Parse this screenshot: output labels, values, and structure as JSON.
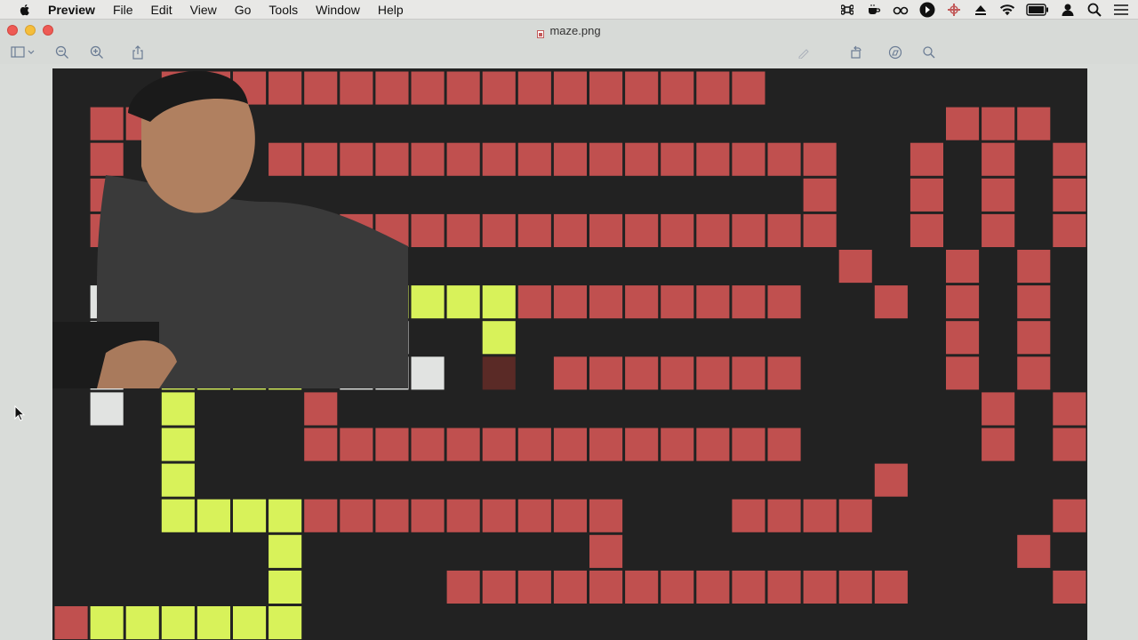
{
  "menubar": {
    "app_name": "Preview",
    "items": [
      "File",
      "Edit",
      "View",
      "Go",
      "Tools",
      "Window",
      "Help"
    ],
    "status_icons": [
      "command-icon",
      "coffee-icon",
      "glasses-icon",
      "play-circle-icon",
      "crosshair-icon",
      "eject-icon",
      "wifi-icon",
      "battery-icon",
      "user-icon",
      "search-icon",
      "list-icon"
    ]
  },
  "window": {
    "title": "maze.png",
    "toolbar_icons": [
      "sidebar-icon",
      "zoom-out-icon",
      "zoom-in-icon",
      "share-icon",
      "markup-icon",
      "rotate-icon",
      "annotate-icon",
      "search-icon"
    ]
  },
  "colors": {
    "wall": "#c0504f",
    "path": "#d8f25a",
    "explored": "#e1e3e1",
    "background": "#222222",
    "goal": "#5a2a26"
  },
  "maze": {
    "rows": [
      "...WWWWWWWWWWWWWWWWW.......",
      ".WWW.....................WWW.W",
      ".W....WWWWWWWWWWWWWWWW..W.W.W",
      ".W...................W..W.W.W",
      ".WWWWWWWWWWWWWWWWWWWWW..W.W.W",
      "......................W..W.W.W",
      ".EEE.PPPPPPPPWWWWWWWW..W.W.W",
      ".E.E.P...E..P............W.W",
      ".E.PPPP.EEE.G.WWWWWWW....W.W",
      ".E.P...W..................W.W",
      "...P...WWWWWWWWWWWWWW.....W.W",
      "...P...................W.....W",
      "...PPPPWWWWWWWWW...WWWW.....W",
      "......P........W...........W",
      "......P....WWWWWWWWWWWWW....W",
      "WPPPPPP......................"
    ]
  }
}
